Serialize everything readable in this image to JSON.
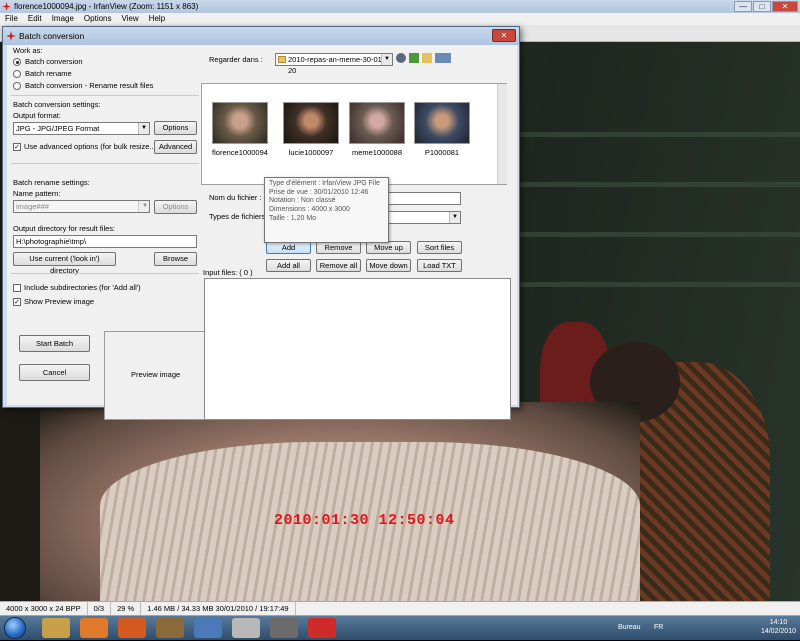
{
  "irfanview": {
    "title": "florence1000094.jpg - IrfanView (Zoom: 1151 x 863)",
    "menu": [
      "File",
      "Edit",
      "Image",
      "Options",
      "View",
      "Help"
    ],
    "window_buttons": {
      "minimize": "—",
      "maximize": "□",
      "close": "✕"
    }
  },
  "photo": {
    "timestamp": "2010:01:30 12:50:04"
  },
  "statusbar": [
    "4000 x 3000 x 24 BPP",
    "0/3",
    "29 %",
    "1.46 MB / 34.33 MB 30/01/2010 / 19:17:49"
  ],
  "dialog": {
    "title": "Batch conversion",
    "close": "✕",
    "work_as": {
      "label": "Work as:",
      "options": [
        "Batch conversion",
        "Batch rename",
        "Batch conversion - Rename result files"
      ],
      "selected": 0
    },
    "conv_settings_label": "Batch conversion settings:",
    "output_format_label": "Output format:",
    "output_format_value": "JPG - JPG/JPEG Format",
    "options_btn": "Options",
    "advanced_chk": "Use advanced options (for bulk resize...)",
    "advanced_btn": "Advanced",
    "rename_settings_label": "Batch rename settings:",
    "name_pattern_label": "Name pattern:",
    "name_pattern_value": "image###",
    "options_btn2": "Options",
    "output_dir_label": "Output directory for result files:",
    "output_dir_value": "H:\\photographie\\tmp\\",
    "use_current_btn": "Use current ('look in') directory",
    "browse_btn": "Browse",
    "include_subdirs": "Include subdirectories (for 'Add all')",
    "show_preview": "Show Preview image",
    "start_batch": "Start Batch",
    "cancel": "Cancel",
    "preview_label": "Preview image",
    "look_in_label": "Regarder dans :",
    "look_in_value": "2010-repas-an-meme-30-01-20",
    "thumbnails": [
      {
        "name": "florence1000094",
        "color": "#6b5a47"
      },
      {
        "name": "lucie1000097",
        "color": "#3f2f27"
      },
      {
        "name": "meme1000088",
        "color": "#6a5a52"
      },
      {
        "name": "P1000081",
        "color": "#3c4a63"
      }
    ],
    "filename_label": "Nom du fichier :",
    "filetypes_label": "Types de fichiers :",
    "buttons_row1": [
      "Add",
      "Remove",
      "Move up",
      "Sort files"
    ],
    "buttons_row2": [
      "Add all",
      "Remove all",
      "Move down",
      "Load TXT"
    ],
    "input_files_label": "Input files: ( 0 )",
    "tooltip": [
      "Type d'élément : IrfanView JPG File",
      "Prise de vue : 30/01/2010 12:46",
      "Notation : Non classé",
      "Dimensions : 4000 x 3000",
      "Taille : 1,20 Mo"
    ]
  },
  "taskbar": {
    "bureau": "Bureau",
    "lang": "FR",
    "time": "14:10",
    "date": "14/02/2010"
  }
}
